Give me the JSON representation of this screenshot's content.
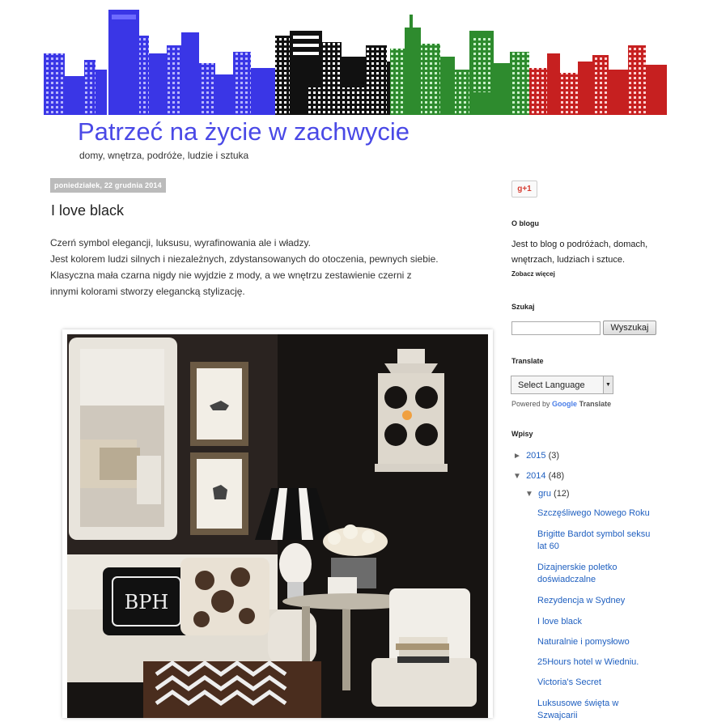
{
  "blog": {
    "title": "Patrzeć na życie w zachwycie",
    "description": "domy, wnętrza, podróże, ludzie i sztuka"
  },
  "post": {
    "date": "poniedziałek, 22 grudnia 2014",
    "title": "I love black",
    "paragraphs": [
      "Czerń symbol elegancji, luksusu, wyrafinowania ale i władzy.",
      "Jest kolorem ludzi silnych i niezależnych, zdystansowanych do otoczenia, pewnych siebie.",
      "Klasyczna mała czarna nigdy nie wyjdzie z mody, a we wnętrzu zestawienie czerni z",
      "innymi kolorami stworzy elegancką stylizację."
    ],
    "monogram": "BPH"
  },
  "sidebar": {
    "gplus_label": "g+1",
    "about": {
      "heading": "O blogu",
      "text": "Jest to blog o podróżach, domach, wnętrzach, ludziach i sztuce.",
      "more": "Zobacz więcej"
    },
    "search": {
      "heading": "Szukaj",
      "value": "",
      "button": "Wyszukaj"
    },
    "translate": {
      "heading": "Translate",
      "select_value": "Select Language",
      "powered_by": "Powered by",
      "google": "Google",
      "translate_word": "Translate"
    },
    "archive": {
      "heading": "Wpisy",
      "years": [
        {
          "toggle": "►",
          "year": "2015",
          "count": "(3)"
        },
        {
          "toggle": "▼",
          "year": "2014",
          "count": "(48)"
        }
      ],
      "month": {
        "toggle": "▼",
        "name": "gru",
        "count": "(12)"
      },
      "posts": [
        "Szczęśliwego Nowego Roku",
        "Brigitte Bardot symbol seksu lat 60",
        "Dizajnerskie poletko doświadczalne",
        "Rezydencja w Sydney",
        "I love black",
        "Naturalnie i pomysłowo",
        "25Hours hotel w Wiedniu.",
        "Victoria's Secret",
        "Luksusowe święta w Szwajcarii"
      ]
    }
  },
  "colors": {
    "title": "#4a49e6",
    "link": "#2060c0",
    "skyline_blue": "#3a36e6",
    "skyline_green": "#2e8b2e",
    "skyline_red": "#c62020"
  }
}
